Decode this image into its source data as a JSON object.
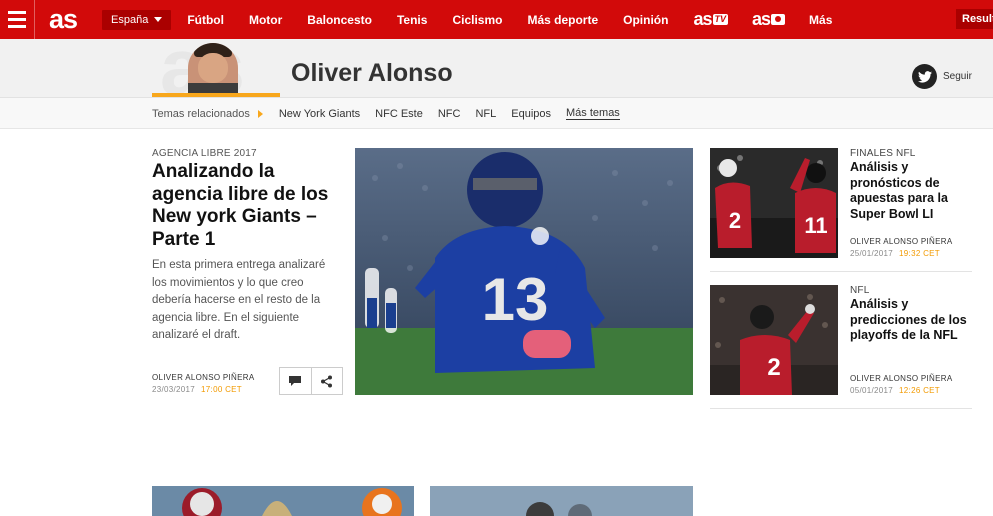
{
  "nav": {
    "logo": "as",
    "country": "España",
    "links": [
      "Fútbol",
      "Motor",
      "Baloncesto",
      "Tenis",
      "Ciclismo",
      "Más deporte",
      "Opinión"
    ],
    "brand_tv": "as",
    "brand_tv_badge": "TV",
    "brand_photo": "as",
    "more": "Más",
    "results": "Resultados"
  },
  "author": {
    "watermark": "as",
    "name": "Oliver Alonso",
    "follow_label": "Seguir"
  },
  "topics": {
    "label": "Temas relacionados",
    "items": [
      "New York Giants",
      "NFC Este",
      "NFC",
      "NFL",
      "Equipos"
    ],
    "more": "Más temas"
  },
  "main_article": {
    "kicker": "AGENCIA LIBRE 2017",
    "title": "Analizando la agencia libre de los New york Giants – Parte 1",
    "excerpt": "En esta primera entrega analizaré los movimientos y lo que creo debería hacerse en el resto de la agencia libre. En el siguiente analizaré el draft.",
    "author": "OLIVER ALONSO PIÑERA",
    "date": "23/03/2017",
    "time": "17:00 CET",
    "image_number": "13"
  },
  "side_articles": [
    {
      "kicker": "FINALES NFL",
      "title": "Análisis y pronósticos de apuestas para la Super Bowl LI",
      "author": "OLIVER ALONSO PIÑERA",
      "date": "25/01/2017",
      "time": "19:32 CET",
      "image_numbers": [
        "2",
        "11"
      ]
    },
    {
      "kicker": "NFL",
      "title": "Análisis y predicciones de los playoffs de la NFL",
      "author": "OLIVER ALONSO PIÑERA",
      "date": "05/01/2017",
      "time": "12:26 CET",
      "image_number": "2"
    }
  ],
  "colors": {
    "brand_red": "#d20a0a",
    "accent_orange": "#f8a71c",
    "time_orange": "#f29a00"
  }
}
